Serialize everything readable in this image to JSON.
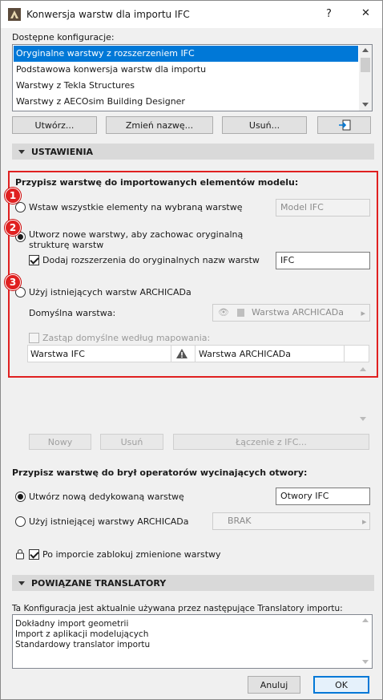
{
  "window": {
    "title": "Konwersja warstw dla importu IFC",
    "help": "?",
    "close": "✕"
  },
  "configs": {
    "label": "Dostępne konfiguracje:",
    "items": [
      "Oryginalne warstwy z rozszerzeniem IFC",
      "Podstawowa konwersja warstw dla importu",
      "Warstwy z  Tekla Structures",
      "Warstwy z AECOsim Building Designer"
    ],
    "selected_index": 0
  },
  "config_buttons": {
    "create": "Utwórz...",
    "rename": "Zmień nazwę...",
    "delete": "Usuń..."
  },
  "settings": {
    "header": "USTAWIENIA",
    "assign_title": "Przypisz warstwę do importowanych elementów modelu:",
    "opt1": "Wstaw wszystkie elementy na wybraną warstwę",
    "opt1_field": "Model IFC",
    "opt2": "Utworz nowe warstwy, aby zachowac oryginalną strukturę warstw",
    "opt2_check": "Dodaj rozszerzenia do oryginalnych nazw warstw",
    "opt2_field": "IFC",
    "opt3": "Użyj istniejących warstw ARCHICADa",
    "default_layer_label": "Domyślna warstwa:",
    "default_layer_value": "Warstwa ARCHICADa",
    "replace_check": "Zastąp domyślne według mapowania:",
    "table_headers": [
      "Warstwa IFC",
      "Warstwa ARCHICADa"
    ],
    "badges": [
      "1",
      "2",
      "3"
    ]
  },
  "mapping_buttons": {
    "new": "Nowy",
    "delete": "Usuń",
    "connect": "Łączenie z IFC..."
  },
  "openings": {
    "title": "Przypisz warstwę do brył operatorów wycinających otwory:",
    "opt1": "Utwórz nową dedykowaną warstwę",
    "opt1_field": "Otwory IFC",
    "opt2": "Użyj istniejącej warstwy ARCHICADa",
    "opt2_select": "BRAK"
  },
  "lock_check": "Po imporcie zablokuj zmienione warstwy",
  "translators": {
    "header": "POWIĄZANE TRANSLATORY",
    "desc": "Ta Konfiguracja jest aktualnie używana przez następujące Translatory importu:",
    "items": [
      "Dokładny import geometrii",
      "Import z aplikacji modelujących",
      "Standardowy translator importu"
    ]
  },
  "footer": {
    "cancel": "Anuluj",
    "ok": "OK"
  },
  "colors": {
    "accent": "#0078d7",
    "highlight_box": "#e02020"
  }
}
